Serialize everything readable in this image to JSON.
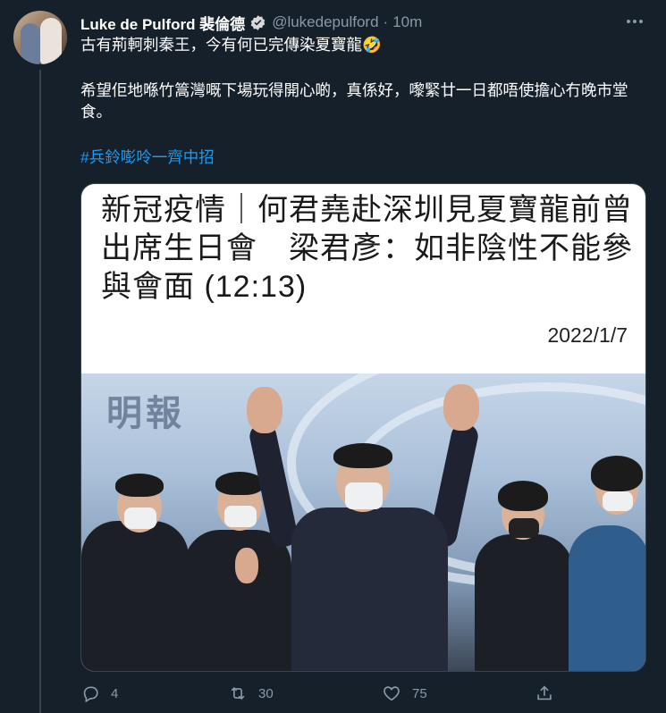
{
  "tweet": {
    "author_name": "Luke de Pulford 裴倫德",
    "handle": "@lukedepulford",
    "separator": "·",
    "time": "10m",
    "line1": "古有荊軻刺秦王，今有何已完傳染夏寶龍🤣",
    "line2": "希望佢地喺竹篙灣嘅下場玩得開心啲，真係好，嚟緊廿一日都唔使擔心冇晚市堂食。",
    "hashtag": "#兵鈴嘭呤一齊中招"
  },
  "card": {
    "headline": "新冠疫情｜何君堯赴深圳見夏寶龍前曾出席生日會　梁君彥：如非陰性不能參與會面 (12:13)",
    "date": "2022/1/7",
    "watermark": "明報"
  },
  "actions": {
    "reply_count": "4",
    "retweet_count": "30",
    "like_count": "75"
  },
  "icons": {
    "verified": "verified-badge-icon",
    "more": "more-icon",
    "reply": "reply-icon",
    "retweet": "retweet-icon",
    "like": "heart-icon",
    "share": "share-icon"
  },
  "colors": {
    "background": "#15202b",
    "text": "#ffffff",
    "secondary": "#8b98a5",
    "accent": "#1d9bf0"
  }
}
